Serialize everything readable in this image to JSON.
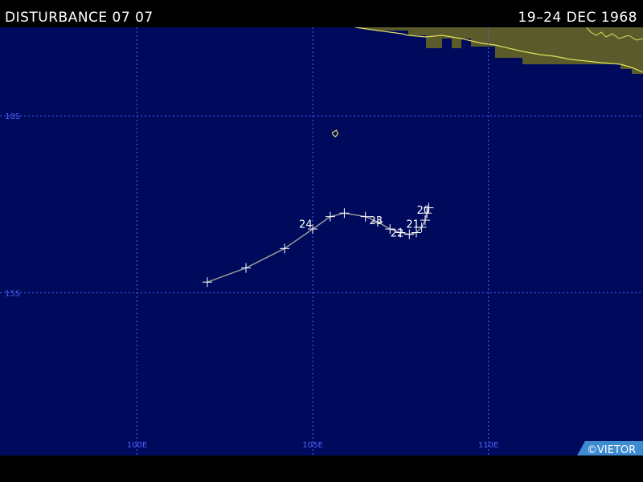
{
  "header": {
    "title": "DISTURBANCE 07 07",
    "date_range": "19–24 DEC 1968"
  },
  "map": {
    "ocean_color": "#000a5c",
    "land_color": "#5a5a2a",
    "coast_color": "#e0e060",
    "grid_color": "#4c63ff",
    "track_color": "#9a9a9a",
    "marker_color": "#ffffff",
    "lat_labels": [
      "10S",
      "15S"
    ],
    "lon_labels": [
      "100E",
      "105E",
      "110E"
    ],
    "lat_lines": [
      -10,
      -15
    ],
    "lon_lines": [
      100,
      105,
      110
    ],
    "bounds": {
      "lon_min": 96.1,
      "lon_max": 114.4,
      "lat_min": -19.6,
      "lat_max": -7.5
    }
  },
  "track": {
    "points": [
      {
        "lon": 108.3,
        "lat": -12.6
      },
      {
        "lon": 108.25,
        "lat": -12.75
      },
      {
        "lon": 108.2,
        "lat": -12.95
      },
      {
        "lon": 108.1,
        "lat": -13.15
      },
      {
        "lon": 107.95,
        "lat": -13.3
      },
      {
        "lon": 107.75,
        "lat": -13.35
      },
      {
        "lon": 107.5,
        "lat": -13.3
      },
      {
        "lon": 107.2,
        "lat": -13.2
      },
      {
        "lon": 106.85,
        "lat": -13.0
      },
      {
        "lon": 106.5,
        "lat": -12.85
      },
      {
        "lon": 105.9,
        "lat": -12.75
      },
      {
        "lon": 105.5,
        "lat": -12.85
      },
      {
        "lon": 105.0,
        "lat": -13.2
      },
      {
        "lon": 104.2,
        "lat": -13.75
      },
      {
        "lon": 103.1,
        "lat": -14.3
      },
      {
        "lon": 102.0,
        "lat": -14.7
      }
    ],
    "day_labels": [
      {
        "text": "20",
        "lon": 108.15,
        "lat": -12.65
      },
      {
        "text": "21",
        "lon": 107.85,
        "lat": -13.05
      },
      {
        "text": "22",
        "lon": 107.4,
        "lat": -13.3
      },
      {
        "text": "23",
        "lon": 106.8,
        "lat": -12.95
      },
      {
        "text": "24",
        "lon": 104.8,
        "lat": -13.05
      }
    ]
  },
  "island_marker": {
    "lon": 105.65,
    "lat": -10.5
  },
  "credit": "©VIETOR"
}
